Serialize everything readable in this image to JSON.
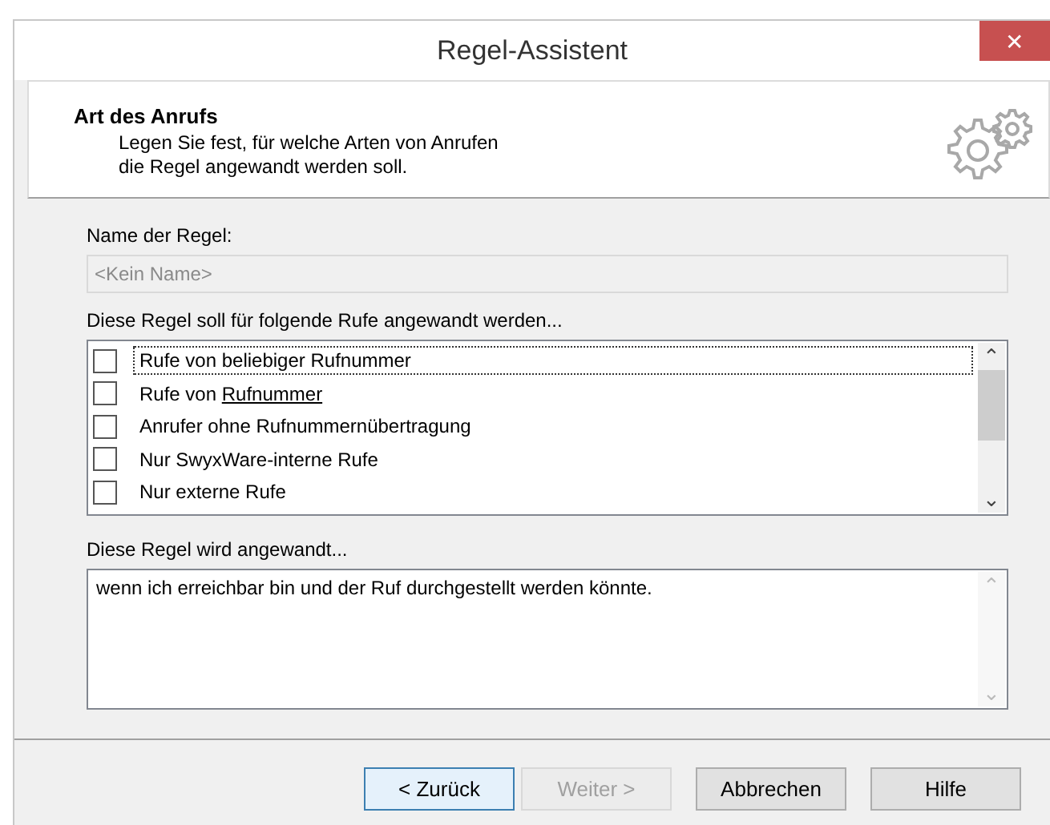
{
  "window": {
    "title": "Regel-Assistent",
    "close": "✕"
  },
  "header": {
    "title": "Art des Anrufs",
    "description": [
      "Legen Sie fest, für welche Arten von Anrufen",
      "die Regel angewandt werden soll."
    ]
  },
  "name_field": {
    "label": "Name der Regel:",
    "placeholder": "<Kein Name>",
    "disabled": true
  },
  "rules_list": {
    "label": "Diese Regel soll für folgende Rufe angewandt werden...",
    "items": [
      {
        "text": "Rufe von beliebiger Rufnummer",
        "checked": false,
        "focused": true
      },
      {
        "text": "Rufe von ",
        "link": "Rufnummer",
        "checked": false,
        "focused": false
      },
      {
        "text": "Anrufer ohne Rufnummernübertragung",
        "checked": false,
        "focused": false
      },
      {
        "text": "Nur SwyxWare-interne Rufe",
        "checked": false,
        "focused": false
      },
      {
        "text": "Nur externe Rufe",
        "checked": false,
        "focused": false
      }
    ],
    "scroll_up": "⌃",
    "scroll_down": "⌄"
  },
  "summary": {
    "label": "Diese Regel wird angewandt...",
    "text": "wenn ich erreichbar bin und der Ruf durchgestellt werden könnte."
  },
  "buttons": [
    {
      "label": "< Zurück",
      "default": true,
      "disabled": false
    },
    {
      "label": "Weiter >",
      "default": false,
      "disabled": true
    },
    {
      "label": "Abbrechen",
      "default": false,
      "disabled": false
    },
    {
      "label": "Hilfe",
      "default": false,
      "disabled": false
    }
  ]
}
